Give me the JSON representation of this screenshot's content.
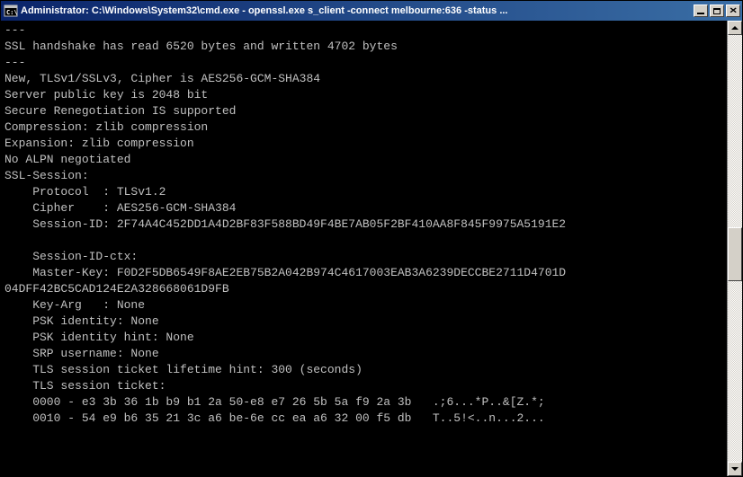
{
  "title": "Administrator: C:\\Windows\\System32\\cmd.exe - openssl.exe  s_client -connect melbourne:636 -status ...",
  "terminal_lines": [
    "---",
    "SSL handshake has read 6520 bytes and written 4702 bytes",
    "---",
    "New, TLSv1/SSLv3, Cipher is AES256-GCM-SHA384",
    "Server public key is 2048 bit",
    "Secure Renegotiation IS supported",
    "Compression: zlib compression",
    "Expansion: zlib compression",
    "No ALPN negotiated",
    "SSL-Session:",
    "    Protocol  : TLSv1.2",
    "    Cipher    : AES256-GCM-SHA384",
    "    Session-ID: 2F74A4C452DD1A4D2BF83F588BD49F4BE7AB05F2BF410AA8F845F9975A5191E2",
    "",
    "    Session-ID-ctx:",
    "    Master-Key: F0D2F5DB6549F8AE2EB75B2A042B974C4617003EAB3A6239DECCBE2711D4701D",
    "04DFF42BC5CAD124E2A328668061D9FB",
    "    Key-Arg   : None",
    "    PSK identity: None",
    "    PSK identity hint: None",
    "    SRP username: None",
    "    TLS session ticket lifetime hint: 300 (seconds)",
    "    TLS session ticket:",
    "    0000 - e3 3b 36 1b b9 b1 2a 50-e8 e7 26 5b 5a f9 2a 3b   .;6...*P..&[Z.*;",
    "    0010 - 54 e9 b6 35 21 3c a6 be-6e cc ea a6 32 00 f5 db   T..5!<..n...2..."
  ]
}
